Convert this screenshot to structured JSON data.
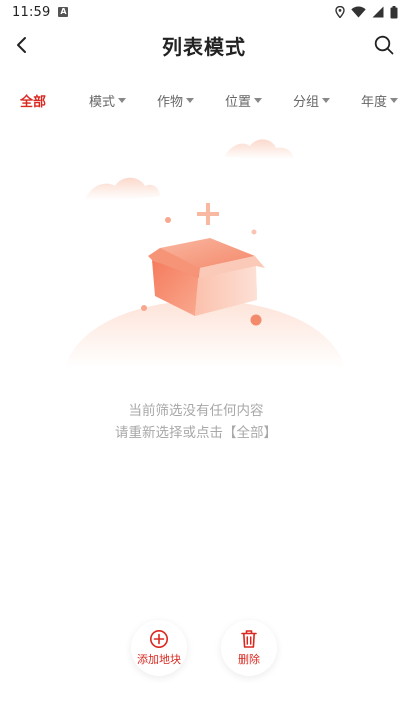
{
  "status_bar": {
    "time": "11:59",
    "notification_glyph": "A",
    "icons": [
      "location-icon",
      "wifi-icon",
      "signal-icon",
      "battery-icon"
    ]
  },
  "header": {
    "title": "列表模式",
    "back_icon": "chevron-left-icon",
    "search_icon": "search-icon"
  },
  "filters": {
    "items": [
      {
        "label": "全部",
        "active": true
      },
      {
        "label": "模式",
        "has_dropdown": true
      },
      {
        "label": "作物",
        "has_dropdown": true
      },
      {
        "label": "位置",
        "has_dropdown": true
      },
      {
        "label": "分组",
        "has_dropdown": true
      },
      {
        "label": "年度",
        "has_dropdown": true
      }
    ]
  },
  "empty_state": {
    "line1": "当前筛选没有任何内容",
    "line2": "请重新选择或点击【全部】",
    "illustration_icon": "empty-box-icon"
  },
  "actions": {
    "add_label": "添加地块",
    "delete_label": "删除",
    "add_icon": "plus-circle-icon",
    "delete_icon": "trash-icon"
  },
  "colors": {
    "accent": "#d9281f",
    "text_muted": "#a8a8a8",
    "filter_text": "#666666",
    "box_orange": "#f47a5c"
  }
}
